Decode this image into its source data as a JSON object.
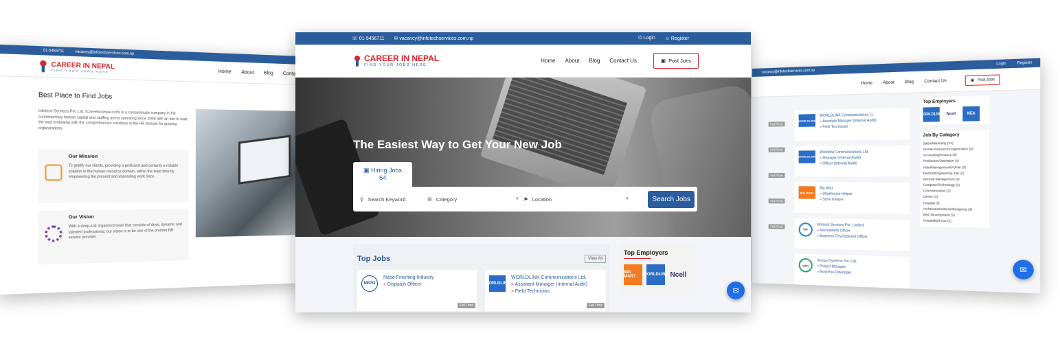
{
  "brand": {
    "name": "CAREER IN NEPAL",
    "tagline": "FIND YOUR JOBS HERE",
    "primary_color": "#2b5d9c",
    "accent_color": "#d9252b"
  },
  "center": {
    "topbar": {
      "phone": "01-5456711",
      "email": "vacancy@infotechservices.com.np",
      "login": "Login",
      "register": "Register"
    },
    "nav": {
      "home": "Home",
      "about": "About",
      "blog": "Blog",
      "contact": "Contact Us",
      "post_jobs": "Post Jobs"
    },
    "hero": {
      "title": "The Easiest Way to Get Your New Job",
      "hiring_label": "Hiring Jobs",
      "hiring_count": "64"
    },
    "search": {
      "keyword_placeholder": "Search Keyword",
      "category_placeholder": "Category",
      "location_placeholder": "Location",
      "button": "Search Jobs"
    },
    "top_jobs": {
      "title": "Top Jobs",
      "view_all": "View All",
      "cards": [
        {
          "logo": "NEPO",
          "company": "Nepo Finishing Industry",
          "positions": [
            "Dispatch Officer"
          ],
          "type": "Full Time"
        },
        {
          "logo": "WORLDLINK",
          "company": "WORLDLINK Communications Ltd.",
          "positions": [
            "Assistant Manager (Internal Audit)",
            "Field Technician"
          ],
          "type": "Full Time"
        }
      ]
    },
    "top_employers": {
      "title": "Top Employers",
      "logos": [
        "BIG MART",
        "WORLDLINK",
        "Ncell"
      ]
    }
  },
  "left": {
    "topbar": {
      "phone": "01-5456711",
      "email": "vacancy@infotechservices.com.np"
    },
    "nav": {
      "home": "Home",
      "about": "About",
      "blog": "Blog",
      "contact": "Conta"
    },
    "heading": "Best Place to Find Jobs",
    "intro": "Infotech Services Pvt. Ltd. (Careerinnepal.com) is a consummate company in the contemporary human capital and staffing arena operating since 2008 with an aim to lead the way endowing with the comprehensive solutions in the HR domain for growing organizations.",
    "mission": {
      "title": "Our Mission",
      "text": "To gratify our clients, providing a proficient and certainly a reliable solution in the human resource domain, within the least time by empowering the present and impending work force."
    },
    "vision": {
      "title": "Our Vision",
      "text": "With a deep-knit organized team that consists of drive, dynamic and talented professional, our vision is to be one of the premier HR service provider."
    }
  },
  "right": {
    "topbar": {
      "email": "vacancy@infotechservices.com.np",
      "login": "Login",
      "register": "Register"
    },
    "nav": {
      "home": "Home",
      "about": "About",
      "blog": "Blog",
      "contact": "Contact Us",
      "post_jobs": "Post Jobs"
    },
    "side_labels": [
      "Full Time",
      "Full Time",
      "Full Time",
      "Full Time",
      "Full Time"
    ],
    "cards": [
      {
        "logo": "WORLDLINK",
        "company": "WORLDLINK Communications Lt...",
        "positions": [
          "Assistant Manager (Internal Audit)",
          "Field Technician"
        ]
      },
      {
        "logo": "WORLDLINK",
        "company": "Worldlink Communications Ltd.",
        "positions": [
          "Manager (Internal Audit)",
          "Officer (Internal Audit)"
        ]
      },
      {
        "logo": "BIG MART",
        "company": "Big Mart",
        "positions": [
          "Warehouse Helper",
          "Store Keeper"
        ]
      },
      {
        "logo": "INF",
        "company": "Infotech Services Pvt. Limited",
        "positions": [
          "Recruitment Officer",
          "Business Development Officer"
        ]
      },
      {
        "logo": "GEN",
        "company": "Genius Systems Pvt. Ltd.",
        "positions": [
          "Project Manager",
          "Business Developer"
        ]
      }
    ],
    "top_employers_title": "Top Employers",
    "top_employers_logos": [
      "WORLDLINK",
      "Ncell",
      "NEA"
    ],
    "categories_title": "Job By Category",
    "categories": [
      "Sales/Marketing (24)",
      "Human Resource/Organization (5)",
      "Accounting/Finance (9)",
      "Production/Operation (4)",
      "Hotel/Management/Admin (3)",
      "Medical/Engineering Job (2)",
      "General Management (5)",
      "Computer/Technology (4)",
      "Communication (2)",
      "Career (1)",
      "Hospital (3)",
      "Architecture/Interior/Designing (4)",
      "Web Development (2)",
      "Hospitality/Food (2)"
    ]
  }
}
